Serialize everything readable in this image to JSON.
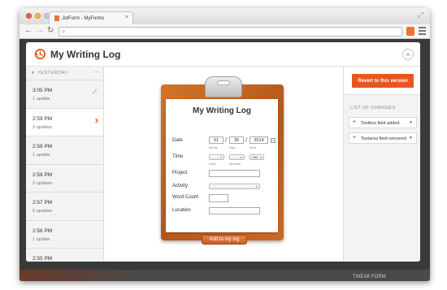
{
  "browser": {
    "tab_title": "JotForm - MyForms",
    "tab_close": "×",
    "url": ""
  },
  "modal": {
    "title": "My Writing Log",
    "close": "×"
  },
  "sidebar": {
    "group_label": "YESTERDAY",
    "collapse": "–",
    "versions": [
      {
        "time": "3:05 PM",
        "updates": "1 update",
        "state": "current"
      },
      {
        "time": "2:59 PM",
        "updates": "2 updates",
        "state": "selected"
      },
      {
        "time": "2:59 PM",
        "updates": "1 update",
        "state": ""
      },
      {
        "time": "2:58 PM",
        "updates": "2 updates",
        "state": ""
      },
      {
        "time": "2:57 PM",
        "updates": "5 updates",
        "state": ""
      },
      {
        "time": "2:56 PM",
        "updates": "1 update",
        "state": ""
      },
      {
        "time": "2:55 PM",
        "updates": "",
        "state": ""
      }
    ]
  },
  "form": {
    "title": "My Writing Log",
    "date_label": "Date",
    "date_month": "01",
    "date_day": "30",
    "date_year": "2014",
    "date_month_sub": "Month",
    "date_day_sub": "Day",
    "date_year_sub": "Year",
    "time_label": "Time",
    "time_ampm": "AM",
    "time_hour_sub": "Hour",
    "time_minutes_sub": "Minutes",
    "project_label": "Project",
    "activity_label": "Activity",
    "word_count_label": "Word Count",
    "location_label": "Location",
    "submit_label": "Add to my log"
  },
  "changes": {
    "revert_label": "Revert to this version",
    "heading": "LIST OF CHANGES",
    "items": [
      {
        "text": "Textbox field added."
      },
      {
        "text": "Textarea field removed."
      }
    ]
  },
  "background": {
    "behind_label": "TWEAK FORM"
  },
  "colors": {
    "accent": "#e8561f",
    "clipboard": "#c4651f",
    "added_icon": "#4bb543"
  }
}
